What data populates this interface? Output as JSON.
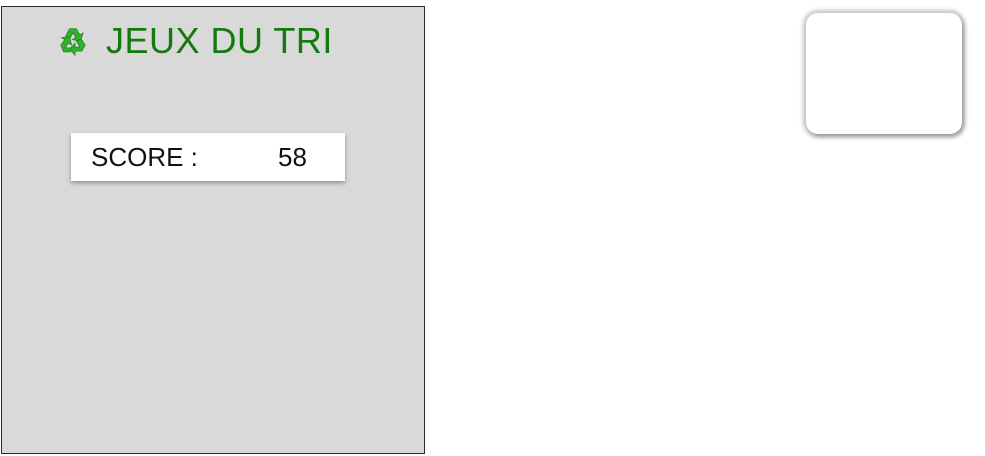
{
  "game": {
    "title": "JEUX DU TRI",
    "title_icon": "recycle-icon",
    "title_color": "#147a0e",
    "panel_background": "#d9d9d9",
    "score": {
      "label": "SCORE :",
      "value": "58"
    }
  }
}
